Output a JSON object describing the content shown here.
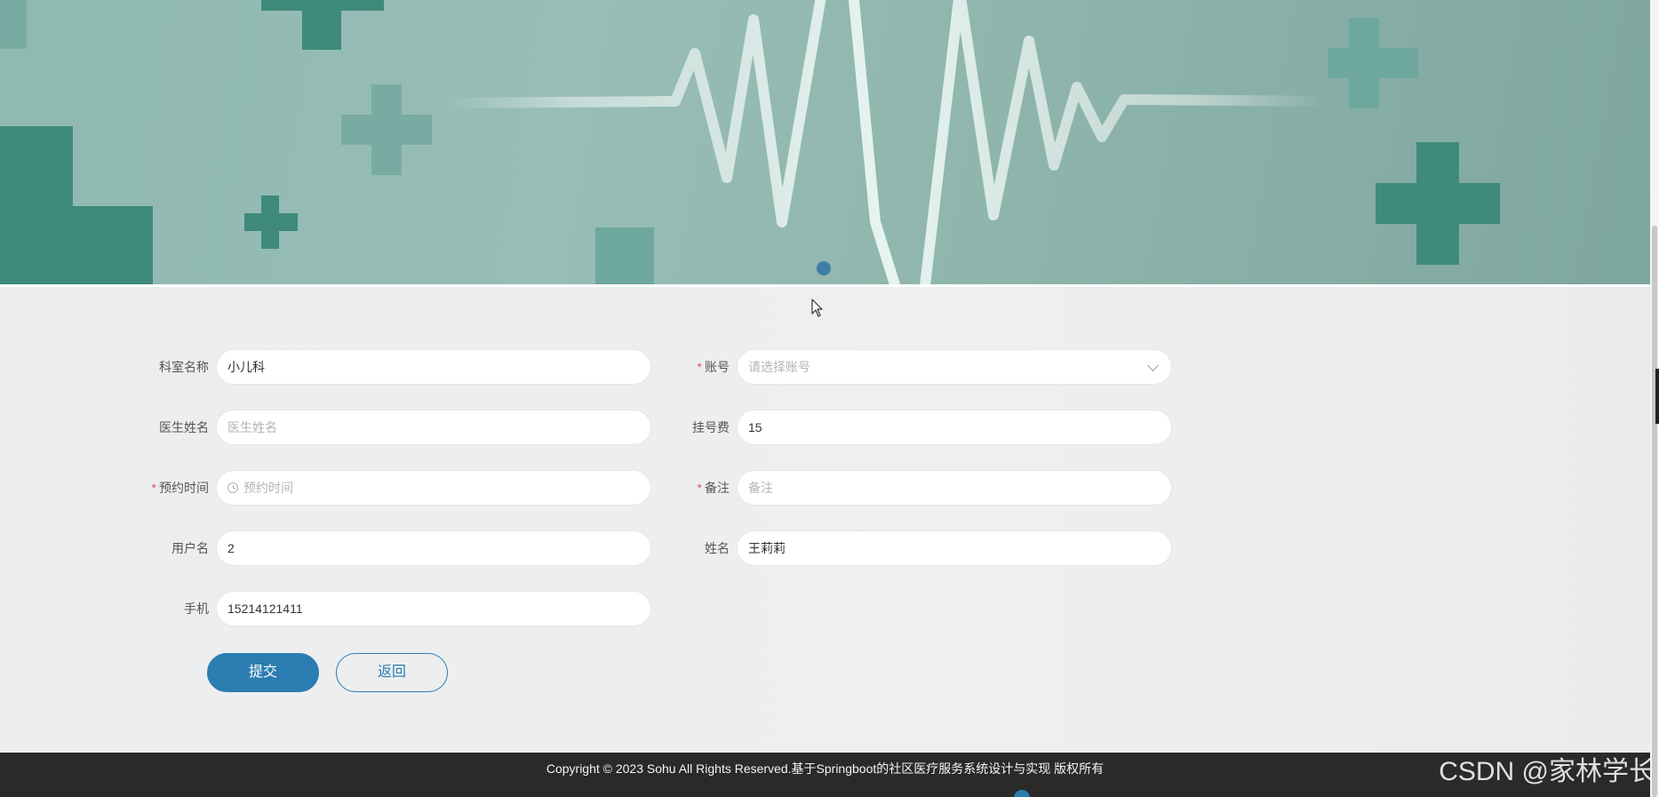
{
  "form": {
    "department_name": {
      "label": "科室名称",
      "value": "小儿科",
      "required": false
    },
    "account": {
      "label": "账号",
      "placeholder": "请选择账号",
      "required": true
    },
    "doctor_name": {
      "label": "医生姓名",
      "placeholder": "医生姓名",
      "required": false
    },
    "registration_fee": {
      "label": "挂号费",
      "value": "15",
      "required": false
    },
    "appointment_time": {
      "label": "预约时间",
      "placeholder": "预约时间",
      "required": true
    },
    "remark": {
      "label": "备注",
      "placeholder": "备注",
      "required": true
    },
    "username": {
      "label": "用户名",
      "value": "2",
      "required": false
    },
    "full_name": {
      "label": "姓名",
      "value": "王莉莉",
      "required": false
    },
    "phone": {
      "label": "手机",
      "value": "15214121411",
      "required": false
    },
    "required_mark": "*"
  },
  "buttons": {
    "submit": "提交",
    "back": "返回"
  },
  "footer": {
    "copyright": "Copyright © 2023 Sohu All Rights Reserved.基于Springboot的社区医疗服务系统设计与实现 版权所有"
  },
  "watermark": "CSDN @家林学长",
  "colors": {
    "accent": "#2b7db1",
    "banner_teal": "#8fb9b1",
    "banner_cross": "#3f8a7c",
    "required": "#e05555",
    "footer_bg": "#2a2a2a"
  },
  "icons": {
    "time_field": "clock-icon",
    "account_select": "chevron-down-icon"
  }
}
